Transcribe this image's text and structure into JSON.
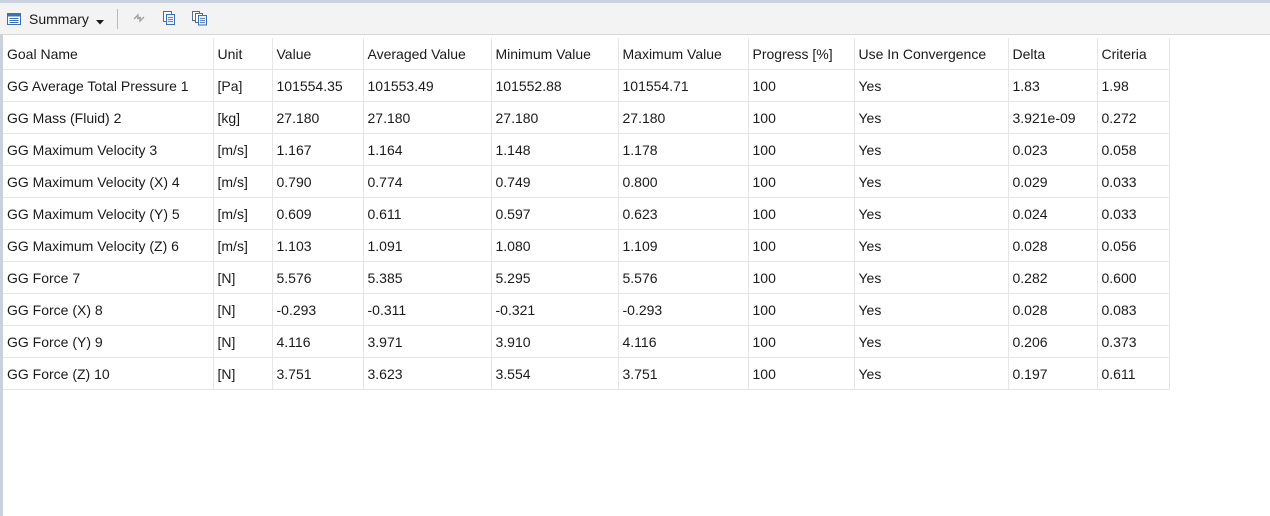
{
  "toolbar": {
    "summary_label": "Summary",
    "icons": [
      "summary-list-icon",
      "dropdown-caret-icon",
      "refresh-icon",
      "copy-icon",
      "copy-all-icon"
    ]
  },
  "table": {
    "columns": [
      "Goal Name",
      "Unit",
      "Value",
      "Averaged Value",
      "Minimum Value",
      "Maximum Value",
      "Progress [%]",
      "Use In Convergence",
      "Delta",
      "Criteria"
    ],
    "rows": [
      [
        "GG Average Total Pressure 1",
        "[Pa]",
        "101554.35",
        "101553.49",
        "101552.88",
        "101554.71",
        "100",
        "Yes",
        "1.83",
        "1.98"
      ],
      [
        "GG Mass (Fluid) 2",
        "[kg]",
        "27.180",
        "27.180",
        "27.180",
        "27.180",
        "100",
        "Yes",
        "3.921e-09",
        "0.272"
      ],
      [
        "GG Maximum Velocity 3",
        "[m/s]",
        "1.167",
        "1.164",
        "1.148",
        "1.178",
        "100",
        "Yes",
        "0.023",
        "0.058"
      ],
      [
        "GG Maximum Velocity (X) 4",
        "[m/s]",
        "0.790",
        "0.774",
        "0.749",
        "0.800",
        "100",
        "Yes",
        "0.029",
        "0.033"
      ],
      [
        "GG Maximum Velocity (Y) 5",
        "[m/s]",
        "0.609",
        "0.611",
        "0.597",
        "0.623",
        "100",
        "Yes",
        "0.024",
        "0.033"
      ],
      [
        "GG Maximum Velocity (Z) 6",
        "[m/s]",
        "1.103",
        "1.091",
        "1.080",
        "1.109",
        "100",
        "Yes",
        "0.028",
        "0.056"
      ],
      [
        "GG Force 7",
        "[N]",
        "5.576",
        "5.385",
        "5.295",
        "5.576",
        "100",
        "Yes",
        "0.282",
        "0.600"
      ],
      [
        "GG Force (X) 8",
        "[N]",
        "-0.293",
        "-0.311",
        "-0.321",
        "-0.293",
        "100",
        "Yes",
        "0.028",
        "0.083"
      ],
      [
        "GG Force (Y) 9",
        "[N]",
        "4.116",
        "3.971",
        "3.910",
        "4.116",
        "100",
        "Yes",
        "0.206",
        "0.373"
      ],
      [
        "GG Force (Z) 10",
        "[N]",
        "3.751",
        "3.623",
        "3.554",
        "3.751",
        "100",
        "Yes",
        "0.197",
        "0.611"
      ]
    ]
  }
}
